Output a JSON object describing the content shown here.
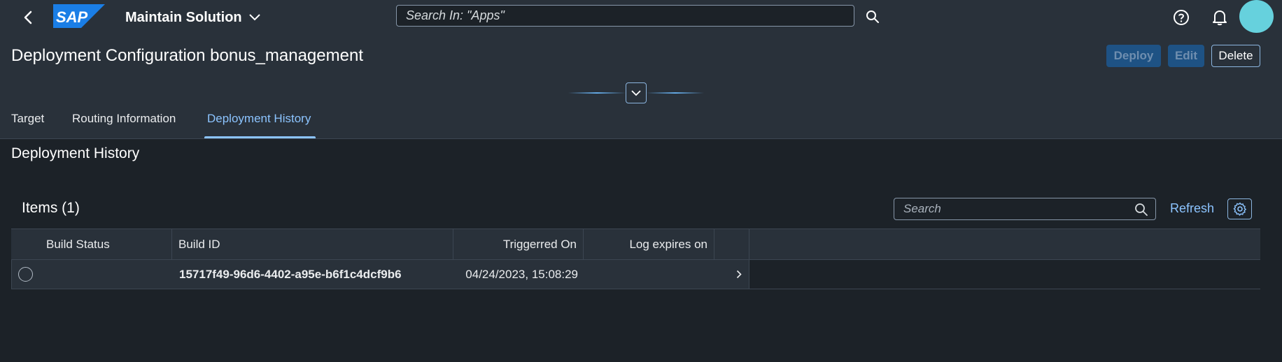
{
  "shell": {
    "app_title": "Maintain Solution",
    "search_placeholder": "Search In: \"Apps\"",
    "logo_text": "SAP",
    "colors": {
      "shell_bg": "#29313a",
      "accent": "#8cc4ff",
      "avatar": "#66d1dd",
      "logo": "#1a7ee6"
    }
  },
  "header": {
    "title": "Deployment Configuration bonus_management",
    "actions": {
      "deploy": "Deploy",
      "edit": "Edit",
      "delete": "Delete"
    },
    "tabs": [
      {
        "label": "Target",
        "active": false
      },
      {
        "label": "Routing Information",
        "active": false
      },
      {
        "label": "Deployment History",
        "active": true
      }
    ]
  },
  "section": {
    "title": "Deployment History",
    "table_title": "Items (1)",
    "search_placeholder": "Search",
    "refresh_label": "Refresh",
    "columns": [
      "Build Status",
      "Build ID",
      "Triggerred On",
      "Log expires on"
    ],
    "rows": [
      {
        "build_status": "",
        "build_id": "15717f49-96d6-4402-a95e-b6f1c4dcf9b6",
        "triggered_on": "04/24/2023, 15:08:29",
        "log_expires_on": ""
      }
    ]
  }
}
